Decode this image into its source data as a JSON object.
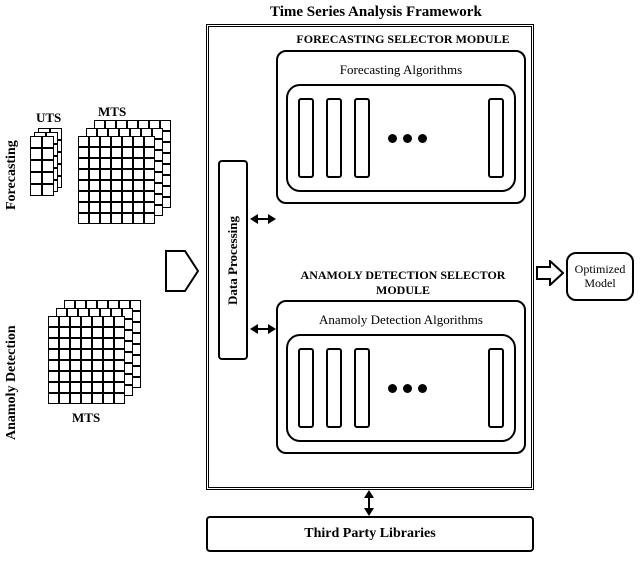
{
  "title": "Time Series Analysis Framework",
  "left_axis": {
    "forecasting": "Forecasting",
    "anomaly": "Anamoly Detection"
  },
  "input_labels": {
    "uts": "UTS",
    "mts_top": "MTS",
    "mts_bottom": "MTS"
  },
  "data_processing": "Data Processing",
  "modules": {
    "forecast": {
      "title": "FORECASTING SELECTOR MODULE",
      "subtitle": "Forecasting Algorithms"
    },
    "anomaly": {
      "title": "ANAMOLY DETECTION SELECTOR MODULE",
      "subtitle": "Anamoly Detection Algorithms"
    }
  },
  "third_party": "Third Party Libraries",
  "output": "Optimized Model",
  "chart_data": {
    "type": "block-diagram",
    "inputs": [
      {
        "name": "Forecasting",
        "channels": [
          "UTS",
          "MTS"
        ]
      },
      {
        "name": "Anamoly Detection",
        "channels": [
          "MTS"
        ]
      }
    ],
    "framework": {
      "name": "Time Series Analysis Framework",
      "stages": [
        "Data Processing",
        {
          "selector": "FORECASTING SELECTOR MODULE",
          "contains": "Forecasting Algorithms"
        },
        {
          "selector": "ANAMOLY DETECTION SELECTOR MODULE",
          "contains": "Anamoly Detection Algorithms"
        }
      ],
      "external": "Third Party Libraries"
    },
    "output": "Optimized Model",
    "connections": [
      [
        "Inputs",
        "Data Processing",
        "uni"
      ],
      [
        "Data Processing",
        "Forecasting Selector Module",
        "bi"
      ],
      [
        "Data Processing",
        "Anamoly Detection Selector Module",
        "bi"
      ],
      [
        "Time Series Analysis Framework",
        "Third Party Libraries",
        "bi"
      ],
      [
        "Time Series Analysis Framework",
        "Optimized Model",
        "uni"
      ]
    ]
  }
}
